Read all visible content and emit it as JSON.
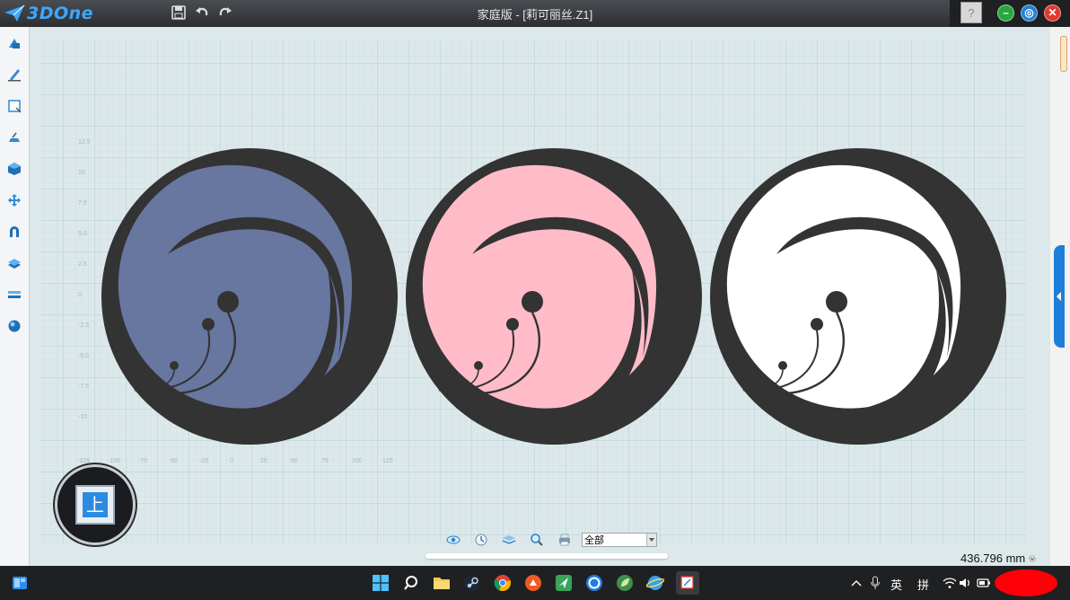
{
  "app": {
    "logo_text": "3DOne",
    "window_title": "家庭版 - [莉可丽丝.Z1]",
    "help_label": "?"
  },
  "window_controls": {
    "minimize": "–",
    "restore": "◎",
    "close": "✕"
  },
  "toolbar": {
    "icons": [
      "save-icon",
      "undo-icon",
      "redo-icon"
    ]
  },
  "sidebar": {
    "icons": [
      "basic-shape-icon",
      "sketch-icon",
      "sketch-edit-icon",
      "special-function-icon",
      "feature-icon",
      "move-icon",
      "combine-icon",
      "pattern-icon",
      "assembly-icon",
      "material-icon"
    ]
  },
  "viewport": {
    "view_cube_label": "上",
    "dimension": "436.796 mm",
    "axis_y_labels": [
      "12.5",
      "10",
      "7.5",
      "5.0",
      "2.5",
      "0",
      "-2.5",
      "-5.0",
      "-7.5",
      "-10"
    ],
    "axis_x_labels": [
      "-125",
      "-100",
      "-75",
      "-50",
      "-25",
      "0",
      "25",
      "50",
      "75",
      "100",
      "125"
    ],
    "models": [
      {
        "name": "blue-disc",
        "fill": "#6877a0"
      },
      {
        "name": "pink-disc",
        "fill": "#ffbcc8"
      },
      {
        "name": "white-disc",
        "fill": "#ffffff"
      }
    ],
    "dark_color": "#333333"
  },
  "bottom_toolbar": {
    "icons": [
      "view-icon",
      "render-mode-icon",
      "layer-icon",
      "zoom-icon",
      "print-icon"
    ],
    "filter_value": "全部"
  },
  "taskbar": {
    "ime_lang": "英",
    "ime_mode": "拼"
  }
}
